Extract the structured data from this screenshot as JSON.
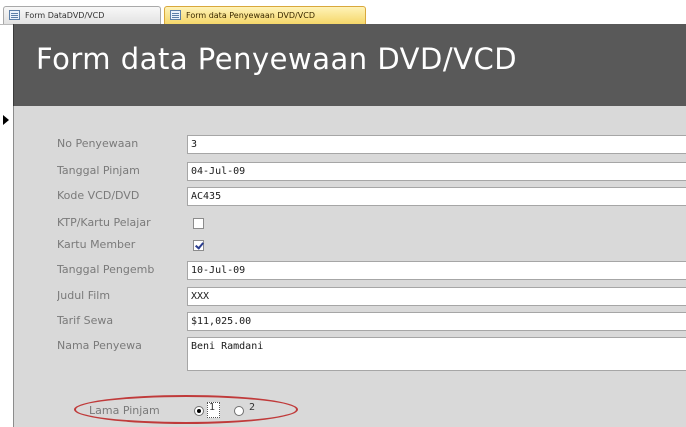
{
  "tabs": [
    {
      "label": "Form DataDVD/VCD",
      "active": false
    },
    {
      "label": "Form data Penyewaan DVD/VCD",
      "active": true
    }
  ],
  "form": {
    "title": "Form data Penyewaan DVD/VCD"
  },
  "fields": {
    "no_penyewaan": {
      "label": "No Penyewaan",
      "value": "3"
    },
    "tanggal_pinjam": {
      "label": "Tanggal Pinjam",
      "value": "04-Jul-09"
    },
    "kode_vcd_dvd": {
      "label": "Kode VCD/DVD",
      "value": "AC435"
    },
    "ktp_kartu_pelajar": {
      "label": "KTP/Kartu Pelajar",
      "checked": false
    },
    "kartu_member": {
      "label": "Kartu Member",
      "checked": true
    },
    "tanggal_pengembalian": {
      "label": "Tanggal Pengemb",
      "value": "10-Jul-09"
    },
    "judul_film": {
      "label": "Judul Film",
      "value": "XXX"
    },
    "tarif_sewa": {
      "label": "Tarif Sewa",
      "value": "$11,025.00"
    },
    "nama_penyewa": {
      "label": "Nama Penyewa",
      "value": "Beni Ramdani"
    }
  },
  "lama_pinjam": {
    "label": "Lama Pinjam",
    "options": [
      "1",
      "2"
    ],
    "selected": "1"
  },
  "colors": {
    "header_bg": "#595959",
    "detail_bg": "#d9d9d9",
    "active_tab": "#f5d76a",
    "annotation": "#c03a3a"
  }
}
